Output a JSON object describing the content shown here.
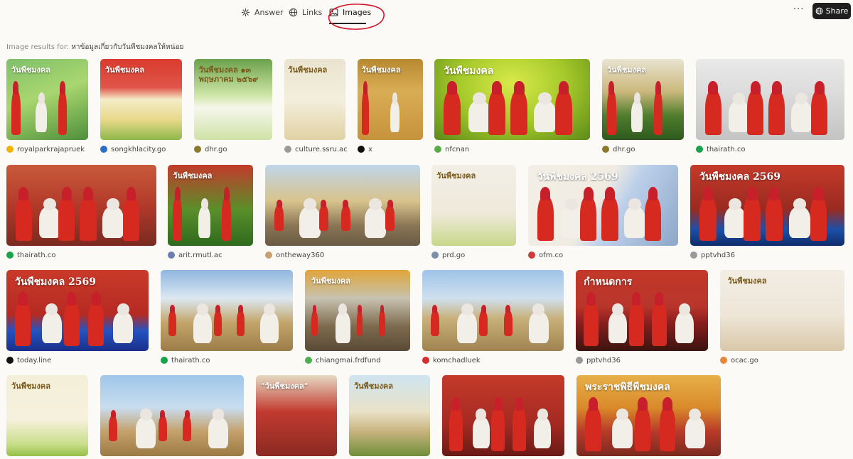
{
  "tabs": [
    {
      "id": "answer",
      "label": "Answer",
      "icon": "sparkle-icon"
    },
    {
      "id": "links",
      "label": "Links",
      "icon": "globe-icon"
    },
    {
      "id": "images",
      "label": "Images",
      "icon": "image-icon",
      "active": true
    }
  ],
  "actions": {
    "more_label": "···",
    "share_label": "Share"
  },
  "results": {
    "prefix": "Image results for:",
    "query": "หาข้อมูลเกี่ยวกับวันพืชมงคลให้หน่อย"
  },
  "colors": {
    "accent": "#1f1f1f",
    "annotation": "#d4172a",
    "background": "#fbfaf7"
  },
  "images": [
    {
      "source": "royalparkrajapruek",
      "fav": "#f0b400",
      "bg": "linear-gradient(160deg,#7fc06a 0%,#a9d66f 45%,#4e8f3b 100%)",
      "text": "วันพืชมงคล",
      "theme": "people-ox"
    },
    {
      "source": "songkhlacity.go",
      "fav": "#2a6fc9",
      "bg": "linear-gradient(180deg,#d93b2d 0%,#e0554a 35%,#f4ecc8 50%,#e8d98a 75%,#8db84a 100%)",
      "text": "วันพืชมงคล",
      "theme": "poster"
    },
    {
      "source": "dhr.go",
      "fav": "#8a7a2a",
      "bg": "linear-gradient(180deg,#6aa24a 0%,#d0e6a8 45%,#f6f6ec 60%,#cfe2a6 100%)",
      "text": "วันพืชมงคล ๑๓ พฤษภาคม ๒๕๖๙",
      "theme": "poster-light"
    },
    {
      "source": "culture.ssru.ac",
      "fav": "#9a9a9a",
      "bg": "linear-gradient(180deg,#e9e3cf 0%,#f4efdd 50%,#e1d2a4 100%)",
      "text": "วันพืชมงคล",
      "theme": "poster-light"
    },
    {
      "source": "x",
      "fav": "#111111",
      "bg": "linear-gradient(180deg,#b8892f 0%,#d9ad55 40%,#c7923c 100%)",
      "text": "วันพืชมงคล",
      "theme": "people-ox"
    },
    {
      "source": "nfcnan",
      "fav": "#5cab4a",
      "bg": "radial-gradient(ellipse at 50% 30%,#d9ea4a 0%,#a4c82a 50%,#5c8a18 100%)",
      "text": "วันพืชมงคล",
      "theme": "people-ox"
    },
    {
      "source": "dhr.go",
      "fav": "#8a7a2a",
      "bg": "linear-gradient(180deg,#e9e4d2 0%,#cbb87c 40%,#4f7d2c 70%,#2e5a1e 100%)",
      "text": "วันพืชมงคล",
      "theme": "people-ox"
    },
    {
      "source": "thairath.co",
      "fav": "#17a34a",
      "bg": "linear-gradient(180deg,#e9e9e9 0%,#dcdcdc 40%,#c4c4c4 100%)",
      "text": "",
      "theme": "people-ox"
    },
    {
      "source": "thairath.co",
      "fav": "#17a34a",
      "bg": "linear-gradient(180deg,#c85a3a 0%,#b23a2a 50%,#7a2a20 100%)",
      "text": "",
      "theme": "people-ox"
    },
    {
      "source": "arit.rmutl.ac",
      "fav": "#6a7fb0",
      "bg": "linear-gradient(180deg,#c33a2a 0%,#5a8f2a 55%,#2f6a1e 100%)",
      "text": "วันพืชมงคล",
      "theme": "people-ox"
    },
    {
      "source": "ontheway360",
      "fav": "#c8a070",
      "bg": "linear-gradient(180deg,#bfd6ea 0%,#d8c38c 45%,#8a7556 75%,#6a5a44 100%)",
      "text": "",
      "theme": "field"
    },
    {
      "source": "prd.go",
      "fav": "#7d8fa8",
      "bg": "linear-gradient(180deg,#f3efe6 0%,#efe9da 60%,#c8d88a 100%)",
      "text": "วันพืชมงคล",
      "theme": "poster-light"
    },
    {
      "source": "ofm.co",
      "fav": "#d03a3a",
      "bg": "linear-gradient(120deg,#f3efe6 0%,#f0ece2 45%,#bcd0ea 60%,#8da7c8 100%)",
      "text": "วันพืชมงคล 2569",
      "theme": "people-ox"
    },
    {
      "source": "pptvhd36",
      "fav": "#9a9a9a",
      "bg": "linear-gradient(180deg,#c43a2a 0%,#9a2a20 55%,#1d4fa8 80%,#0f2d6a 100%)",
      "text": "วันพืชมงคล 2569",
      "theme": "people-ox"
    },
    {
      "source": "today.line",
      "fav": "#111111",
      "bg": "linear-gradient(180deg,#c93a2a 0%,#b52a22 55%,#2553c0 75%,#1a2f8a 100%)",
      "text": "วันพืชมงคล 2569",
      "theme": "people-ox"
    },
    {
      "source": "thairath.co",
      "fav": "#17a34a",
      "bg": "linear-gradient(180deg,#8fb6de 0%,#dce8f2 35%,#c3a56a 65%,#9c7c48 100%)",
      "text": "",
      "theme": "field"
    },
    {
      "source": "chiangmai.frdfund",
      "fav": "#4caf50",
      "bg": "linear-gradient(180deg,#e0a53a 0%,#c7c2b0 35%,#7d6a4e 70%,#5a4a36 100%)",
      "text": "วันพืชมงคล",
      "theme": "field"
    },
    {
      "source": "komchadluek",
      "fav": "#d32f2f",
      "bg": "linear-gradient(180deg,#9fc4e8 0%,#cfe0ef 35%,#c8b07a 60%,#a08350 100%)",
      "text": "",
      "theme": "field"
    },
    {
      "source": "pptvhd36",
      "fav": "#9a9a9a",
      "bg": "linear-gradient(180deg,#c3382a 0%,#b9352b 45%,#8a1e1e 65%,#3b140f 100%)",
      "text": "กำหนดการ",
      "theme": "people-ox"
    },
    {
      "source": "ocac.go",
      "fav": "#e6883a",
      "bg": "linear-gradient(180deg,#f2ede4 0%,#eee6d8 55%,#d9c7a8 100%)",
      "text": "วันพืชมงคล",
      "theme": "poster-light"
    },
    {
      "source": "",
      "fav": "",
      "bg": "linear-gradient(180deg,#f4efd9 0%,#f6f1dc 55%,#c9de8a 85%,#95bf4a 100%)",
      "text": "วันพืชมงคล",
      "theme": "poster-light"
    },
    {
      "source": "",
      "fav": "",
      "bg": "linear-gradient(180deg,#9fc6ea 0%,#c9ddee 40%,#c4a06a 70%,#9c7a44 100%)",
      "text": "",
      "theme": "field"
    },
    {
      "source": "",
      "fav": "",
      "bg": "linear-gradient(180deg,#e6dac3 0%,#c23a30 45%,#8a2a22 100%)",
      "text": "\"วันพืชมงคล\"",
      "theme": "poster"
    },
    {
      "source": "",
      "fav": "",
      "bg": "linear-gradient(180deg,#cfe4f0 0%,#e9e2c8 45%,#c7b27c 70%,#6f8f3a 100%)",
      "text": "วันพืชมงคล",
      "theme": "poster-light"
    },
    {
      "source": "",
      "fav": "",
      "bg": "linear-gradient(180deg,#c43a2a 0%,#a52a22 60%,#6a1a16 100%)",
      "text": "",
      "theme": "people-ox"
    },
    {
      "source": "",
      "fav": "",
      "bg": "linear-gradient(180deg,#e7b048 0%,#d98a2a 40%,#b8392a 70%,#7a2a1e 100%)",
      "text": "พระราชพิธีพืชมงคล",
      "theme": "people-ox"
    }
  ]
}
